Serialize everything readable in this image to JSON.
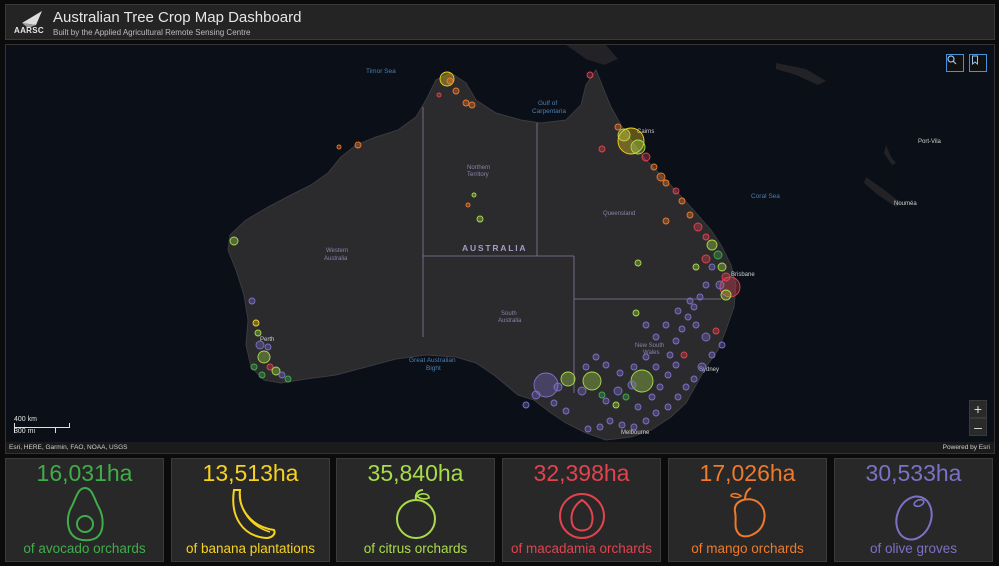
{
  "header": {
    "logo_text": "AARSC",
    "title": "Australian Tree Crop Map Dashboard",
    "subtitle": "Built by the Applied Agricultural Remote Sensing Centre"
  },
  "map": {
    "search_icon": "search-icon",
    "bookmark_icon": "bookmark-icon",
    "zoom_in": "+",
    "zoom_out": "–",
    "scale_km": "400 km",
    "scale_mi": "300 mi",
    "attribution": "Esri, HERE, Garmin, FAO, NOAA, USGS",
    "powered_by": "Powered by Esri",
    "labels": {
      "timor_sea": "Timor Sea",
      "gulf_line1": "Gulf of",
      "gulf_line2": "Carpentaria",
      "coral_sea": "Coral Sea",
      "australia": "AUSTRALIA",
      "nt_line1": "Northern",
      "nt_line2": "Territory",
      "queensland": "Queensland",
      "wa_line1": "Western",
      "wa_line2": "Australia",
      "sa_line1": "South",
      "sa_line2": "Australia",
      "nsw_line1": "New South",
      "nsw_line2": "Wales",
      "bight_line1": "Great Australian",
      "bight_line2": "Bight",
      "port_vila": "Port-Vila",
      "noumea": "Nouméa",
      "cairns": "Cairns",
      "brisbane": "Brisbane",
      "sydney": "Sydney",
      "perth": "Perth",
      "melbourne": "Melbourne"
    }
  },
  "cards": [
    {
      "value": "16,031ha",
      "caption": "of avocado orchards",
      "color": "#3fae4a",
      "icon": "avocado-icon"
    },
    {
      "value": "13,513ha",
      "caption": "of banana plantations",
      "color": "#f5d320",
      "icon": "banana-icon"
    },
    {
      "value": "35,840ha",
      "caption": "of citrus orchards",
      "color": "#a9dc4a",
      "icon": "citrus-icon"
    },
    {
      "value": "32,398ha",
      "caption": "of macadamia orchards",
      "color": "#e2434f",
      "icon": "macadamia-icon"
    },
    {
      "value": "17,026ha",
      "caption": "of mango orchards",
      "color": "#f07a2a",
      "icon": "mango-icon"
    },
    {
      "value": "30,533ha",
      "caption": "of olive groves",
      "color": "#7b71c9",
      "icon": "olive-icon"
    }
  ]
}
